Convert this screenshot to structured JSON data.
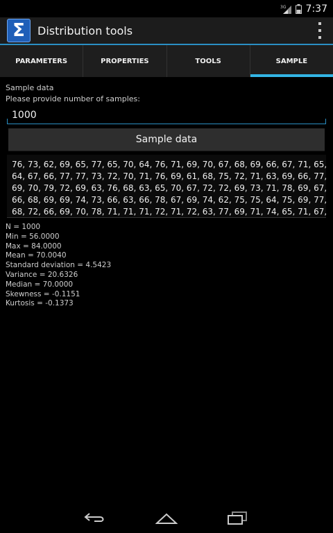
{
  "status_bar": {
    "time": "7:37",
    "network": "3G"
  },
  "app": {
    "title": "Distribution tools",
    "icon_glyph": "Σ"
  },
  "tabs": [
    {
      "label": "PARAMETERS",
      "active": false
    },
    {
      "label": "PROPERTIES",
      "active": false
    },
    {
      "label": "TOOLS",
      "active": false
    },
    {
      "label": "SAMPLE",
      "active": true
    }
  ],
  "sample": {
    "section_label": "Sample data",
    "prompt": "Please provide number of samples:",
    "count_value": "1000",
    "button_label": "Sample data",
    "lines": [
      "76, 73, 62, 69, 65, 77, 65, 70, 64, 76, 71, 69, 70, 67, 68, 69, 66, 67, 71, 65,",
      "64, 67, 66, 77, 77, 73, 72, 70, 71, 76, 69, 61, 68, 75, 72, 71, 63, 69, 66, 77,",
      "69, 70, 79, 72, 69, 63, 76, 68, 63, 65, 70, 67, 72, 72, 69, 73, 71, 78, 69, 67,",
      "66, 68, 69, 69, 74, 73, 66, 63, 66, 78, 67, 69, 74, 62, 75, 75, 64, 75, 69, 77,",
      "68, 72, 66, 69, 70, 78, 71, 71, 71, 72, 71, 72, 63, 77, 69, 71, 74, 65, 71, 67,"
    ]
  },
  "stats": [
    "N = 1000",
    "Min = 56.0000",
    "Max = 84.0000",
    "Mean = 70.0040",
    "Standard deviation = 4.5423",
    "Variance = 20.6326",
    "Median = 70.0000",
    "Skewness = -0.1151",
    "Kurtosis = -0.1373"
  ],
  "colors": {
    "accent": "#33b5e5",
    "action_bar": "#1c1c1c",
    "background": "#000000"
  },
  "icons": {
    "overflow": "overflow-menu-icon",
    "back": "back-icon",
    "home": "home-icon",
    "recents": "recents-icon"
  }
}
